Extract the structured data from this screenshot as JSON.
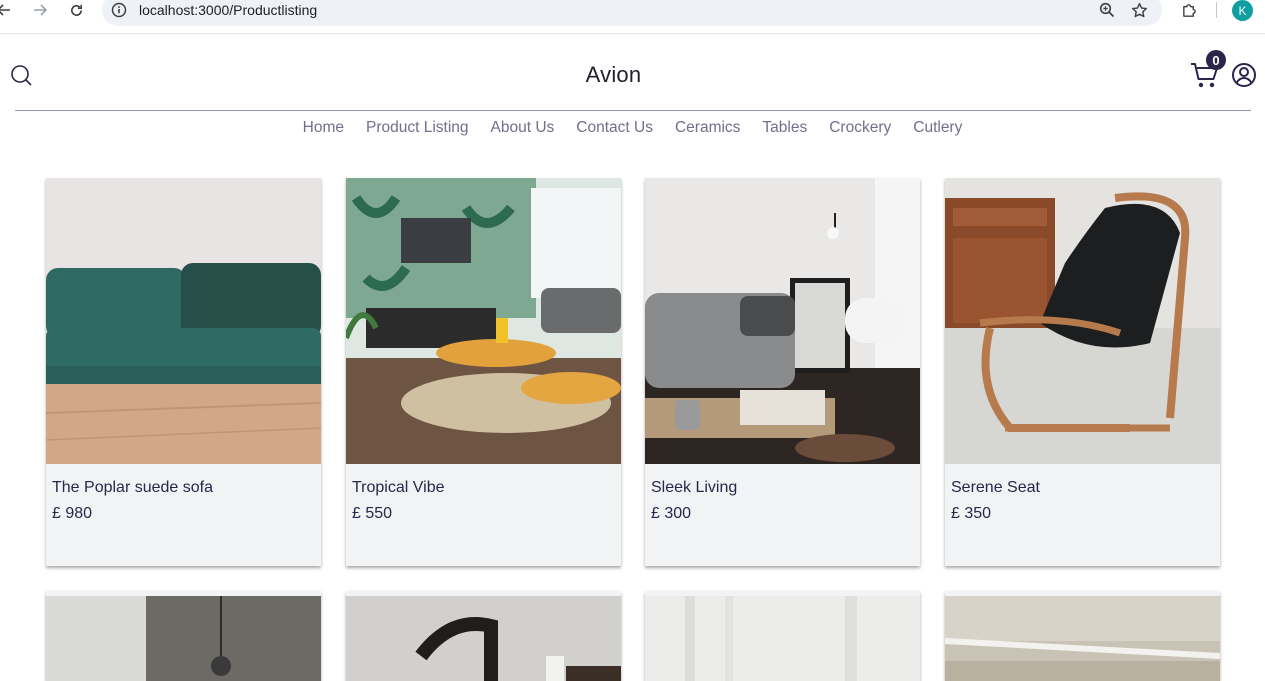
{
  "browser": {
    "url": "localhost:3000/Productlisting",
    "profile_initial": "K"
  },
  "site": {
    "brand": "Avion",
    "cart_count": "0",
    "nav": [
      "Home",
      "Product Listing",
      "About Us",
      "Contact Us",
      "Ceramics",
      "Tables",
      "Crockery",
      "Cutlery"
    ]
  },
  "products": [
    {
      "title": "The Poplar suede sofa",
      "price": "£ 980"
    },
    {
      "title": "Tropical Vibe",
      "price": "£ 550"
    },
    {
      "title": "Sleek Living",
      "price": "£ 300"
    },
    {
      "title": "Serene Seat",
      "price": "£ 350"
    }
  ],
  "colors": {
    "brand_text": "#22202e",
    "nav_text": "#726e8d",
    "card_bg": "#f2f3f5",
    "badge_bg": "#2a254b",
    "avatar_bg": "#0f9fa3"
  }
}
